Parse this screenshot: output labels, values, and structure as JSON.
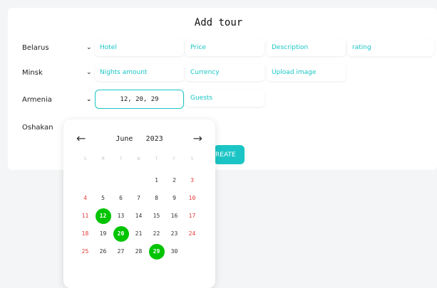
{
  "page": {
    "title": "Add tour"
  },
  "left_labels": [
    "Belarus",
    "Minsk",
    "Armenia",
    "Oshakan"
  ],
  "fields": {
    "hotel": "Hotel",
    "price": "Price",
    "description": "Description",
    "rating": "rating",
    "nights_amount": "Nights amount",
    "currency": "Currency",
    "upload_image": "Upload image",
    "guests": "Guests"
  },
  "date_input": {
    "value": "12, 20, 29"
  },
  "create_button": {
    "label": "REATE"
  },
  "calendar": {
    "month": "June",
    "year": "2023",
    "weekdays": [
      "S",
      "M",
      "T",
      "W",
      "T",
      "F",
      "S"
    ],
    "rows": [
      [
        "",
        "",
        "",
        "",
        "1",
        "2",
        "3"
      ],
      [
        "4",
        "5",
        "6",
        "7",
        "8",
        "9",
        "10"
      ],
      [
        "11",
        "12",
        "13",
        "14",
        "15",
        "16",
        "17"
      ],
      [
        "18",
        "19",
        "20",
        "21",
        "22",
        "23",
        "24"
      ],
      [
        "25",
        "26",
        "27",
        "28",
        "29",
        "30",
        ""
      ]
    ],
    "selected_days": [
      "12",
      "20",
      "29"
    ],
    "colors": {
      "accent": "#1bc5c5",
      "selected": "#00c400",
      "weekend": "#e53935"
    }
  },
  "icons": {
    "prev": "arrow-left-icon",
    "next": "arrow-right-icon",
    "select": "chevron-down-icon"
  }
}
